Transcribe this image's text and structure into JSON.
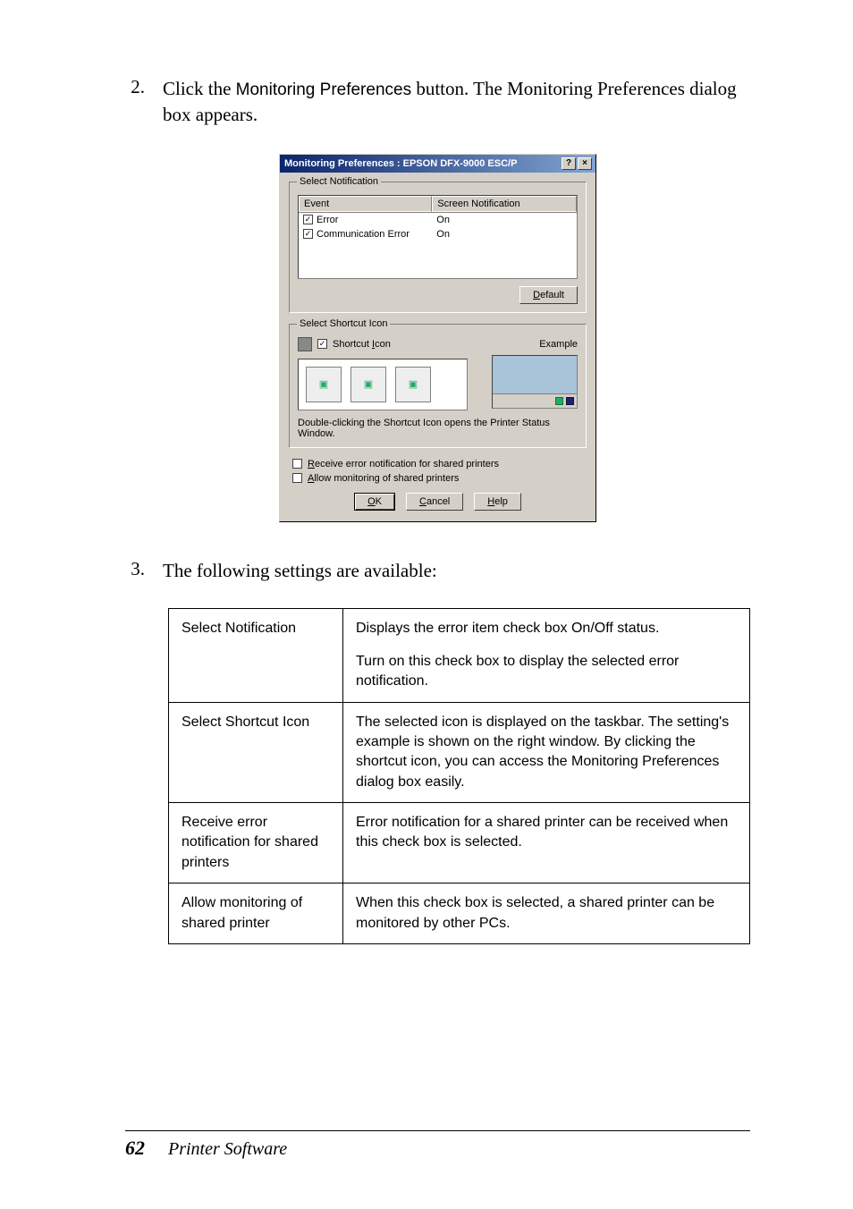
{
  "steps": {
    "s2": {
      "num": "2.",
      "pre": "Click the ",
      "button_name": "Monitoring Preferences",
      "post": " button. The Monitoring Preferences dialog box appears."
    },
    "s3": {
      "num": "3.",
      "text": "The following settings are available:"
    }
  },
  "dialog": {
    "title": "Monitoring Preferences : EPSON DFX-9000 ESC/P",
    "help_btn": "?",
    "close_btn": "×",
    "group_select_notification": "Select Notification",
    "col_event": "Event",
    "col_notification": "Screen Notification",
    "rows": [
      {
        "name": "Error",
        "status": "On",
        "checked": "✓"
      },
      {
        "name": "Communication Error",
        "status": "On",
        "checked": "✓"
      }
    ],
    "default_btn_pre": "D",
    "default_btn_rest": "efault",
    "group_shortcut": "Select Shortcut Icon",
    "shortcut_label_pre": "Shortcut ",
    "shortcut_label_u": "I",
    "shortcut_label_post": "con",
    "example_label": "Example",
    "shortcut_hint": "Double-clicking the Shortcut Icon opens the Printer Status Window.",
    "receive_pre": "R",
    "receive_rest": "eceive error notification for shared printers",
    "allow_pre": "A",
    "allow_rest": "llow monitoring of shared printers",
    "ok_u": "O",
    "ok_rest": "K",
    "cancel_u": "C",
    "cancel_rest": "ancel",
    "helpbtn_u": "H",
    "helpbtn_rest": "elp"
  },
  "table": {
    "r1": {
      "label": "Select Notification",
      "p1": "Displays the error item check box On/Off status.",
      "p2": "Turn on this check box to display the selected error notification."
    },
    "r2": {
      "label": "Select Shortcut Icon",
      "p1": "The selected icon is displayed on the taskbar. The setting's example is shown on the right window. By clicking the shortcut icon, you can access the Monitoring Preferences dialog box easily."
    },
    "r3": {
      "label": "Receive error notification for shared printers",
      "p1": "Error notification for a shared printer can be received when this check box is selected."
    },
    "r4": {
      "label": "Allow monitoring of shared printer",
      "p1": "When this check box is selected, a shared printer can be monitored by other PCs."
    }
  },
  "footer": {
    "page": "62",
    "title": "Printer Software"
  }
}
